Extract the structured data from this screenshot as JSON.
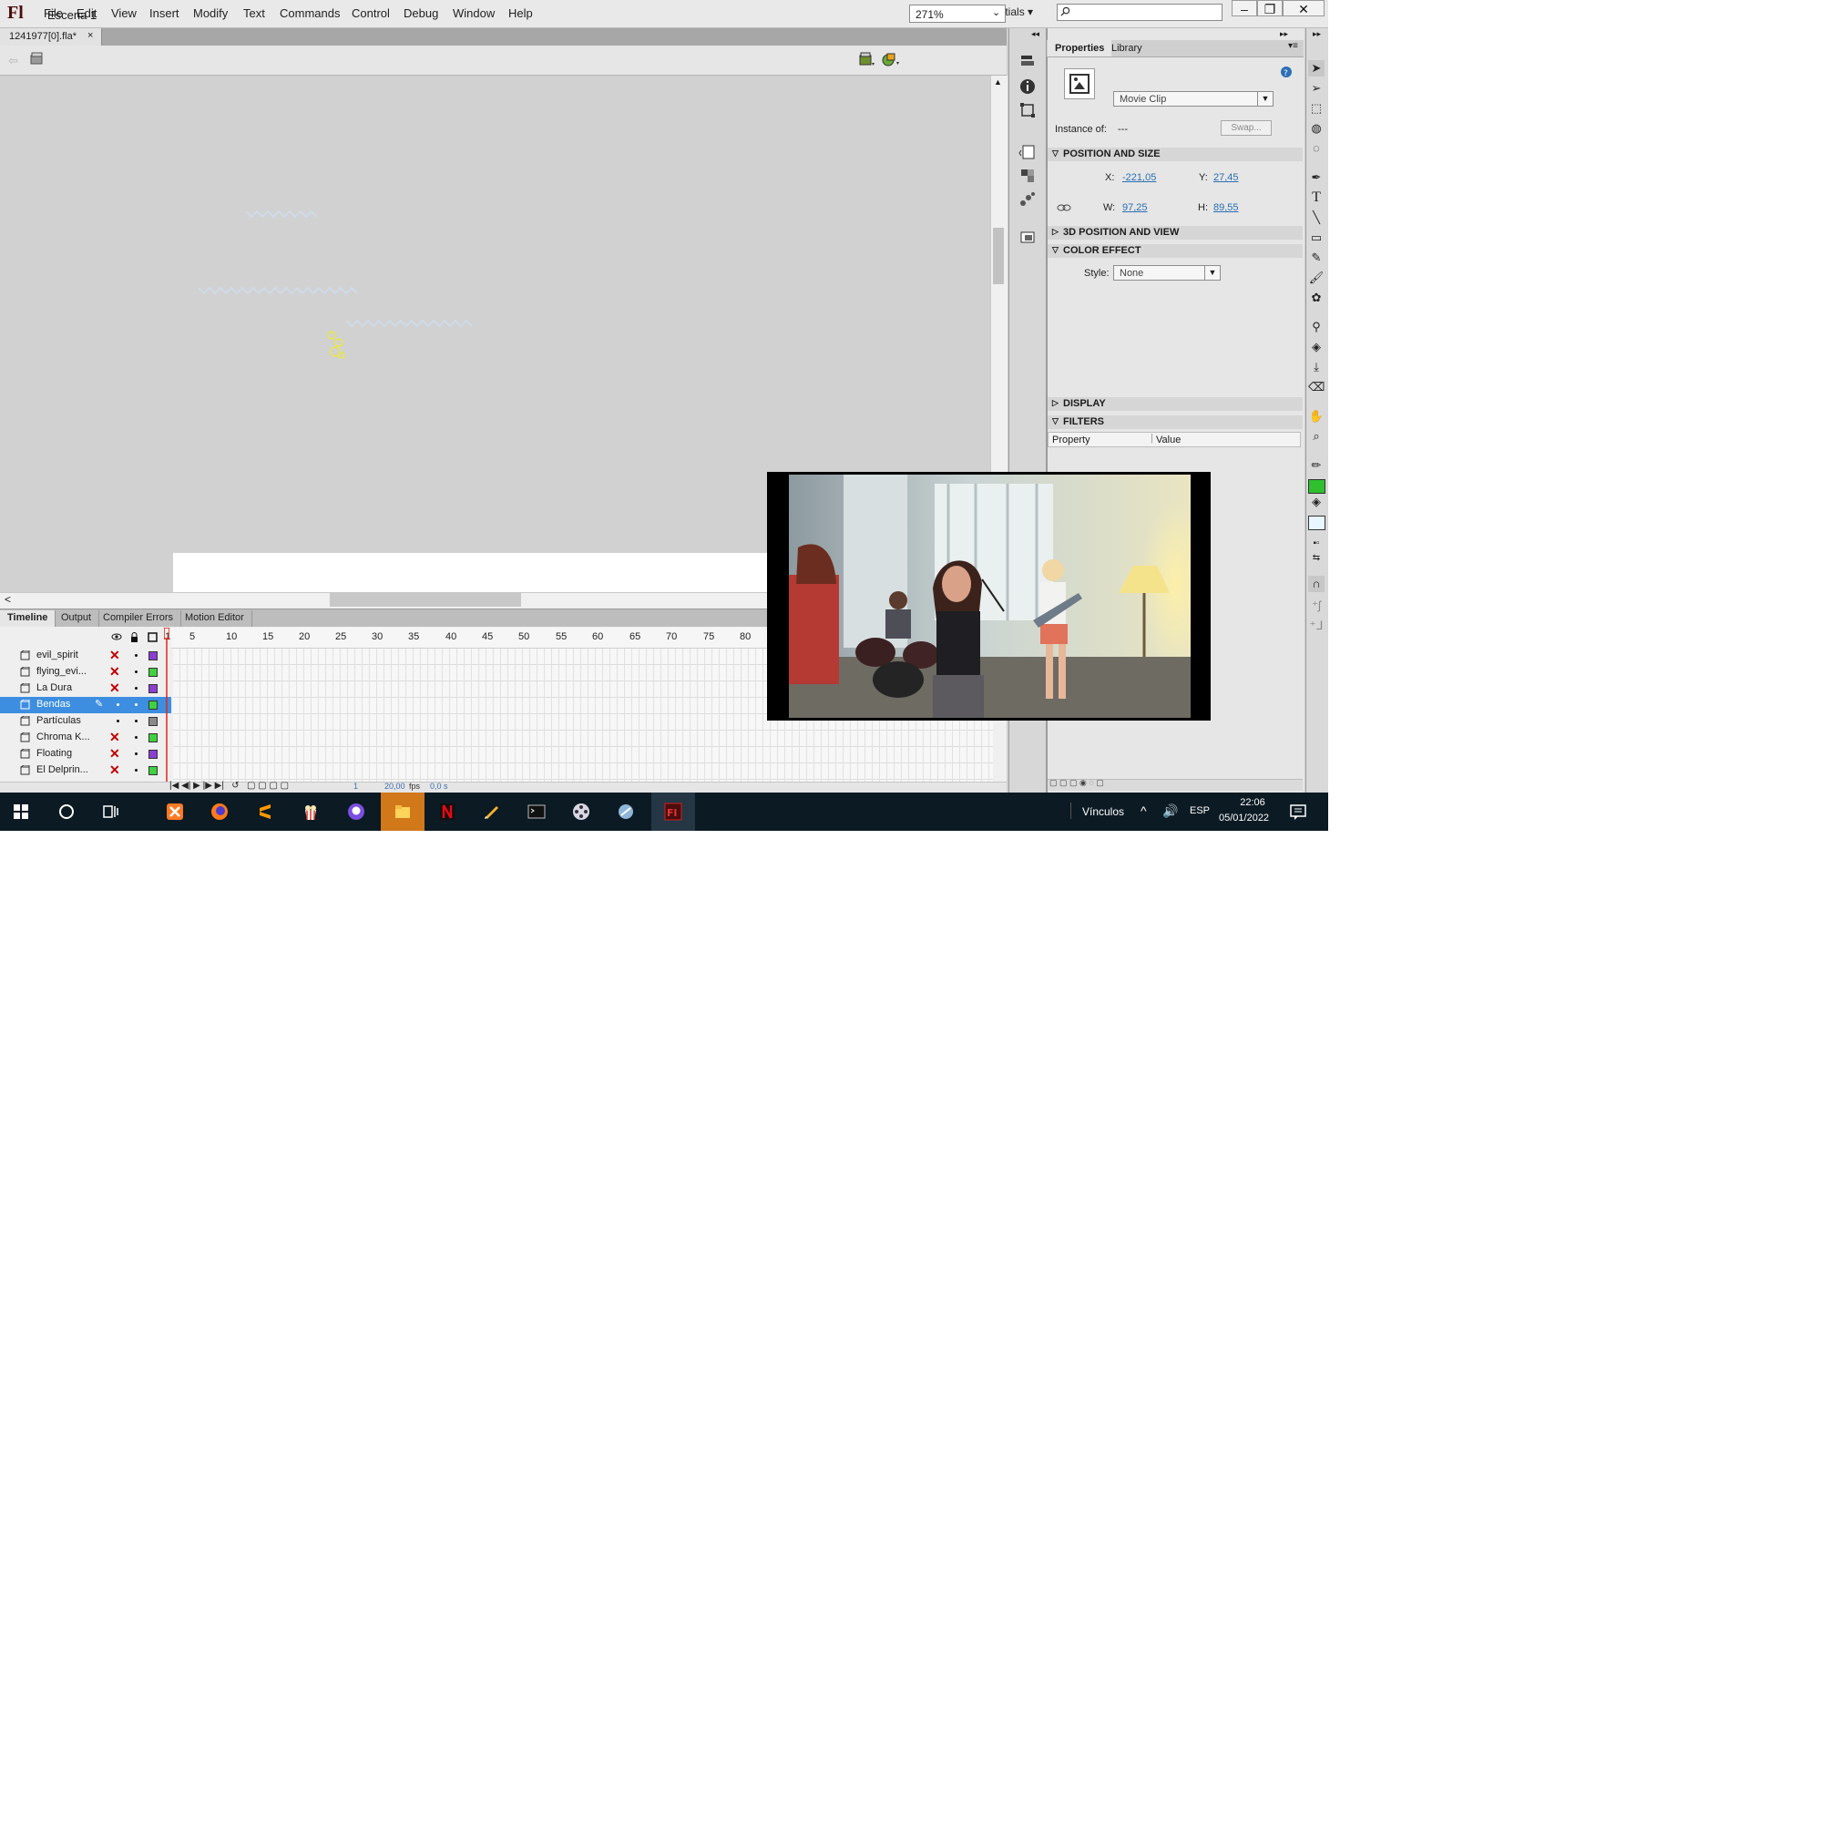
{
  "app": {
    "logo": "Fl",
    "menu": [
      "File",
      "Edit",
      "View",
      "Insert",
      "Modify",
      "Text",
      "Commands",
      "Control",
      "Debug",
      "Window",
      "Help"
    ],
    "workspace": "Essentials",
    "window_buttons": [
      "–",
      "❐",
      "✕"
    ]
  },
  "document": {
    "tab_title": "1241977[0].fla*",
    "tab_close": "×",
    "scene": "Escena 1",
    "zoom": "271%"
  },
  "timeline": {
    "tabs": [
      "Timeline",
      "Output",
      "Compiler Errors",
      "Motion Editor"
    ],
    "ruler_ticks": [
      "1",
      "5",
      "10",
      "15",
      "20",
      "25",
      "30",
      "35",
      "40",
      "45",
      "50",
      "55",
      "60",
      "65",
      "70",
      "75",
      "80"
    ],
    "layers": [
      {
        "name": "evil_spirit",
        "color": "#8b3fd1",
        "hidden": true
      },
      {
        "name": "flying_evi...",
        "color": "#3fd13f",
        "hidden": true
      },
      {
        "name": "La Dura",
        "color": "#8b3fd1",
        "hidden": true
      },
      {
        "name": "Bendas",
        "color": "#3fd13f",
        "hidden": false,
        "selected": true
      },
      {
        "name": "Partículas",
        "color": "#8a8a8a",
        "hidden": false
      },
      {
        "name": "Chroma K...",
        "color": "#3fd13f",
        "hidden": true
      },
      {
        "name": "Floating",
        "color": "#8b3fd1",
        "hidden": true
      },
      {
        "name": "El Delprin...",
        "color": "#3fd13f",
        "hidden": true
      }
    ],
    "status": {
      "frame": "1",
      "fps": "20,00",
      "fps_unit": "fps",
      "time": "0,0 s"
    }
  },
  "properties": {
    "tabs": [
      "Properties",
      "Library"
    ],
    "symbol_type": "Movie Clip",
    "instance_of_label": "Instance of:",
    "instance_of_value": "---",
    "swap_label": "Swap...",
    "sections": {
      "position_size": "POSITION AND SIZE",
      "position_3d": "3D POSITION AND VIEW",
      "color_effect": "COLOR EFFECT",
      "display": "DISPLAY",
      "filters": "FILTERS"
    },
    "x_label": "X:",
    "x_value": "-221,05",
    "y_label": "Y:",
    "y_value": "27,45",
    "w_label": "W:",
    "w_value": "97,25",
    "h_label": "H:",
    "h_value": "89,55",
    "style_label": "Style:",
    "style_value": "None",
    "filters_cols": [
      "Property",
      "Value"
    ]
  },
  "taskbar": {
    "tray_label": "Vínculos",
    "language": "ESP",
    "time": "22:06",
    "date": "05/01/2022"
  },
  "colors": {
    "accent_selected": "#3d8ee0",
    "timeline_playhead": "#e0251f",
    "stage_bg": "#d1d1d1"
  }
}
